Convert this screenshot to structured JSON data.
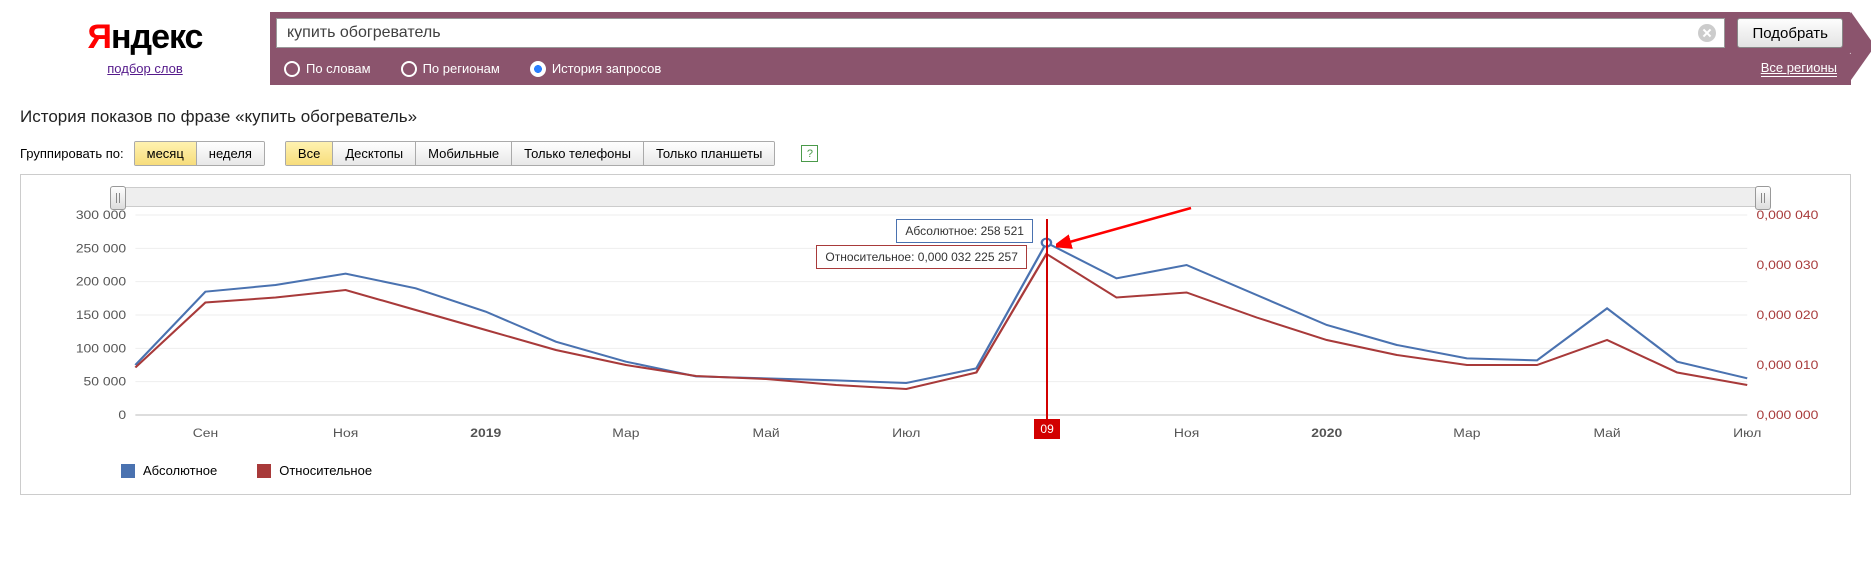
{
  "header": {
    "logo_red": "Я",
    "logo_rest": "ндекс",
    "sub_link": "подбор слов",
    "query": "купить обогреватель",
    "submit": "Подобрать",
    "radios": {
      "by_words": "По словам",
      "by_regions": "По регионам",
      "history": "История запросов"
    },
    "regions": "Все регионы"
  },
  "subtitle": "История показов по фразе «купить обогреватель»",
  "filters": {
    "group_label": "Группировать по:",
    "group": {
      "month": "месяц",
      "week": "неделя"
    },
    "device": {
      "all": "Все",
      "desktop": "Десктопы",
      "mobile": "Мобильные",
      "phones": "Только телефоны",
      "tablets": "Только планшеты"
    }
  },
  "legend": {
    "abs": "Абсолютное",
    "rel": "Относительное"
  },
  "tooltip": {
    "abs": "Абсолютное: 258 521",
    "rel": "Относительное: 0,000 032 225 257"
  },
  "highlight_flag": "09",
  "axes": {
    "y1_ticks": [
      "0",
      "50 000",
      "100 000",
      "150 000",
      "200 000",
      "250 000",
      "300 000"
    ],
    "y2_ticks": [
      "0,000 000",
      "0,000 010",
      "0,000 020",
      "0,000 030",
      "0,000 040"
    ],
    "x_labels": [
      "Сен",
      "Ноя",
      "2019",
      "Мар",
      "Май",
      "Июл",
      "Сен",
      "Ноя",
      "2020",
      "Мар",
      "Май",
      "Июл"
    ]
  },
  "chart_data": {
    "type": "line",
    "title": "История показов по фразе «купить обогреватель»",
    "xlabel": "",
    "y1_label": "Абсолютное",
    "y2_label": "Относительное",
    "y1_lim": [
      0,
      300000
    ],
    "y2_lim": [
      0,
      4e-05
    ],
    "x": [
      "2018-08",
      "2018-09",
      "2018-10",
      "2018-11",
      "2018-12",
      "2019-01",
      "2019-02",
      "2019-03",
      "2019-04",
      "2019-05",
      "2019-06",
      "2019-07",
      "2019-08",
      "2019-09",
      "2019-10",
      "2019-11",
      "2019-12",
      "2020-01",
      "2020-02",
      "2020-03",
      "2020-04",
      "2020-05",
      "2020-06",
      "2020-07"
    ],
    "series": [
      {
        "name": "Абсолютное",
        "axis": "y1",
        "values": [
          75000,
          185000,
          195000,
          212000,
          190000,
          155000,
          110000,
          80000,
          58000,
          55000,
          52000,
          48000,
          70000,
          258521,
          205000,
          225000,
          180000,
          135000,
          105000,
          85000,
          82000,
          160000,
          80000,
          55000
        ]
      },
      {
        "name": "Относительное",
        "axis": "y2",
        "values": [
          9.5e-06,
          2.25e-05,
          2.35e-05,
          2.5e-05,
          2.1e-05,
          1.7e-05,
          1.3e-05,
          1e-05,
          7.8e-06,
          7.2e-06,
          6e-06,
          5.2e-06,
          8.5e-06,
          3.2225257e-05,
          2.35e-05,
          2.45e-05,
          1.95e-05,
          1.5e-05,
          1.2e-05,
          1e-05,
          1e-05,
          1.5e-05,
          8.5e-06,
          6e-06
        ]
      }
    ],
    "highlight_index": 13
  }
}
